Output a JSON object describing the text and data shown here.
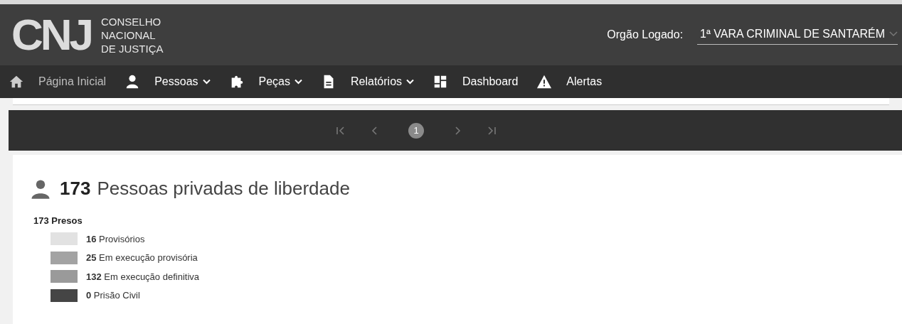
{
  "header": {
    "logo": {
      "mark": "CNJ",
      "lines": [
        "CONSELHO",
        "NACIONAL",
        "DE JUSTIÇA"
      ]
    },
    "orgao_label": "Orgão Logado:",
    "orgao_value": "1ª VARA CRIMINAL DE SANTARÉM"
  },
  "nav": [
    {
      "kind": "home",
      "label": "Página Inicial",
      "dropdown": false,
      "selected": true
    },
    {
      "kind": "person",
      "label": "Pessoas",
      "dropdown": true,
      "selected": false
    },
    {
      "kind": "puzzle",
      "label": "Peças",
      "dropdown": true,
      "selected": false
    },
    {
      "kind": "document",
      "label": "Relatórios",
      "dropdown": true,
      "selected": false
    },
    {
      "kind": "dashboard",
      "label": "Dashboard",
      "dropdown": false,
      "selected": false
    },
    {
      "kind": "warning",
      "label": "Alertas",
      "dropdown": false,
      "selected": false
    }
  ],
  "pagination": {
    "pages": [
      {
        "label": "1",
        "selected": true
      }
    ]
  },
  "summary": {
    "count": "173",
    "title": "Pessoas privadas de liberdade",
    "total": "173 Presos",
    "legend": [
      {
        "count": "16",
        "label": "Provisórios",
        "color": "#e2e2e2"
      },
      {
        "count": "25",
        "label": "Em execução provisória",
        "color": "#a3a3a3"
      },
      {
        "count": "132",
        "label": "Em execução definitiva",
        "color": "#9a9a9a"
      },
      {
        "count": "0",
        "label": "Prisão Civil",
        "color": "#454545"
      }
    ]
  }
}
